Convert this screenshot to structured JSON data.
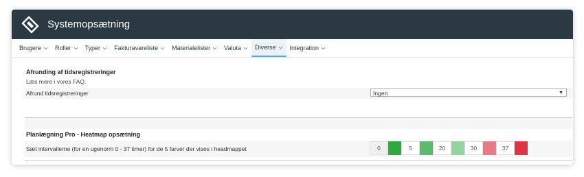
{
  "app": {
    "title": "Systemopsætning",
    "logo_icon": "app-logo-icon"
  },
  "nav": {
    "items": [
      {
        "label": "Brugere"
      },
      {
        "label": "Roller"
      },
      {
        "label": "Typer"
      },
      {
        "label": "Fakturavareliste"
      },
      {
        "label": "Materialelister"
      },
      {
        "label": "Valuta"
      },
      {
        "label": "Diverse",
        "active": true
      },
      {
        "label": "Integration"
      }
    ],
    "chevron_icon": "chevron-down-icon"
  },
  "rounding": {
    "title": "Afrunding af tidsregistreringer",
    "faq_text": "Læs mere i vores FAQ.",
    "field_label": "Afrund tidsregistreringer",
    "select_value": "Ingen"
  },
  "heatmap": {
    "title": "Planlægning Pro - Heatmap opsætning",
    "description": "Sæt intervallerne (for en ugenorm 0 - 37 timer) for de 5 farver der vises i headmappet",
    "thresholds": [
      "0",
      "5",
      "20",
      "30",
      "37"
    ],
    "colors": [
      "#2ea83f",
      "#5cba6c",
      "#96d2a0",
      "#e77a86",
      "#dc3545"
    ]
  },
  "colors": {
    "titlebar": "#2b3a42",
    "active_tab_border": "#55a7d4"
  }
}
